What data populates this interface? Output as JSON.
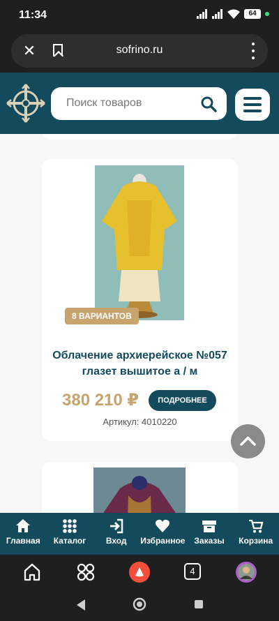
{
  "status_bar": {
    "time": "11:34",
    "battery": "64"
  },
  "browser": {
    "url": "sofrino.ru"
  },
  "header": {
    "search_placeholder": "Поиск товаров"
  },
  "product": {
    "badge": "8 ВАРИАНТОВ",
    "title_line1": "Облачение архиерейское №057",
    "title_line2": "глазет вышитое а / м",
    "price": "380 210 ₽",
    "more_label": "ПОДРОБНЕЕ",
    "sku": "Артикул: 4010220"
  },
  "bottom_nav": [
    {
      "label": "Главная",
      "icon": "home-icon"
    },
    {
      "label": "Каталог",
      "icon": "grid-icon"
    },
    {
      "label": "Вход",
      "icon": "login-icon"
    },
    {
      "label": "Избранное",
      "icon": "heart-icon"
    },
    {
      "label": "Заказы",
      "icon": "box-icon"
    },
    {
      "label": "Корзина",
      "icon": "cart-icon"
    }
  ],
  "android": {
    "tabs_count": "4"
  },
  "colors": {
    "brand": "#134a5c",
    "accent": "#c7a46e"
  }
}
